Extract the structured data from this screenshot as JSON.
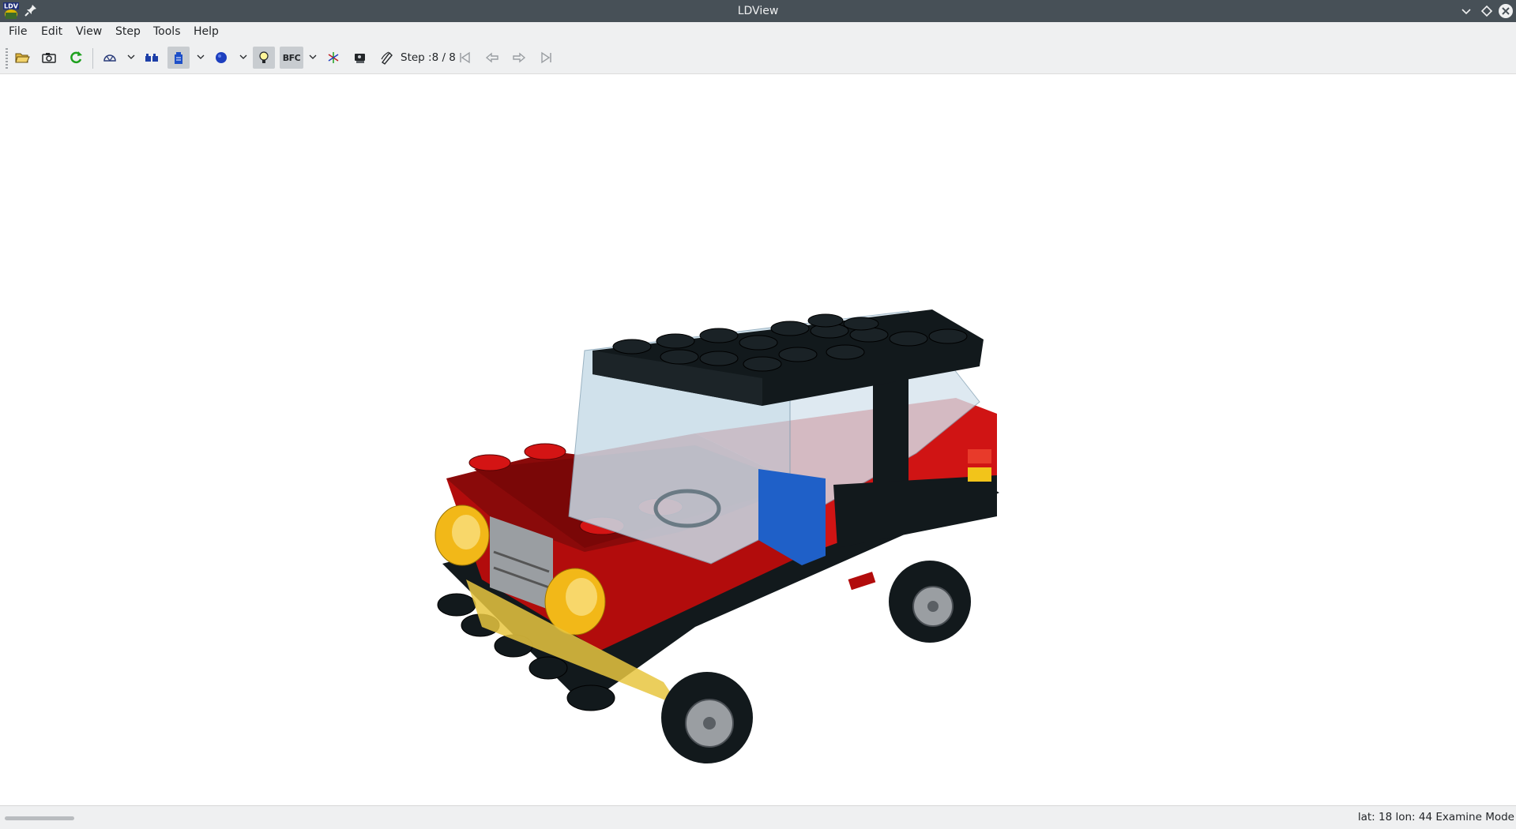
{
  "window": {
    "title": "LDView",
    "app_icon_text": "LDV"
  },
  "menu": {
    "items": [
      "File",
      "Edit",
      "View",
      "Step",
      "Tools",
      "Help"
    ]
  },
  "toolbar": {
    "step_label": "Step :8 / 8",
    "bfc_label": "BFC",
    "icons": [
      "open-file-icon",
      "screenshot-icon",
      "reload-icon",
      "view-angle-icon",
      "parts-list-icon",
      "model-tree-icon",
      "colors-icon",
      "lighting-icon",
      "bfc-icon",
      "axes-icon",
      "camera-icon",
      "properties-icon",
      "first-step-icon",
      "previous-step-icon",
      "next-step-icon",
      "last-step-icon"
    ]
  },
  "viewport": {
    "content": "3D LEGO model: red car with black roof, transparent windshield and black wheels"
  },
  "status": {
    "text": "lat: 18 lon: 44  Examine Mode"
  },
  "colors": {
    "titlebar": "#475057",
    "chrome": "#eff0f1",
    "brick_red": "#c80e0e",
    "brick_black": "#12191c",
    "trans_yellow": "#f5c518",
    "trans_clear": "#c8dce8"
  }
}
